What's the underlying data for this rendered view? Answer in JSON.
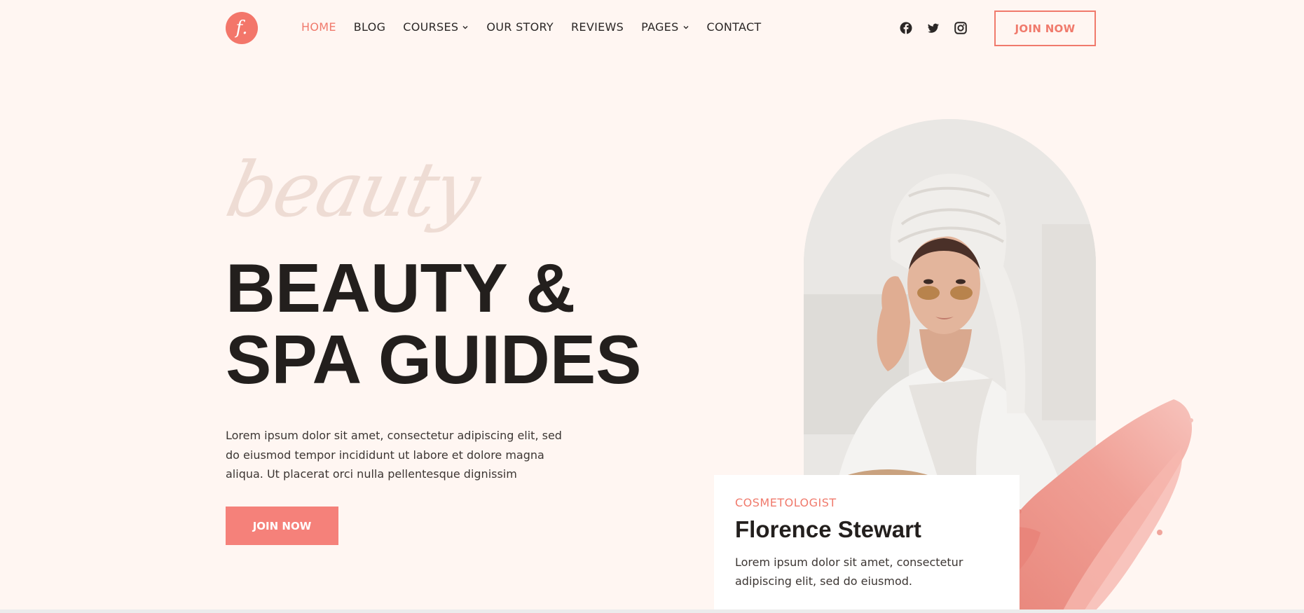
{
  "header": {
    "logo_text": "f.",
    "nav": [
      {
        "label": "HOME",
        "active": true,
        "dropdown": false
      },
      {
        "label": "BLOG",
        "active": false,
        "dropdown": false
      },
      {
        "label": "COURSES",
        "active": false,
        "dropdown": true
      },
      {
        "label": "OUR STORY",
        "active": false,
        "dropdown": false
      },
      {
        "label": "REVIEWS",
        "active": false,
        "dropdown": false
      },
      {
        "label": "PAGES",
        "active": false,
        "dropdown": true
      },
      {
        "label": "CONTACT",
        "active": false,
        "dropdown": false
      }
    ],
    "socials": [
      "facebook-icon",
      "twitter-icon",
      "instagram-icon"
    ],
    "cta_label": "JOIN NOW"
  },
  "hero": {
    "script_word": "beauty",
    "title_line1": "BEAUTY &",
    "title_line2": "SPA GUIDES",
    "description": "Lorem ipsum dolor sit amet, consectetur adipiscing elit, sed do eiusmod tempor incididunt ut labore et dolore magna aliqua. Ut placerat orci nulla pellentesque dignissim",
    "cta_label": "JOIN NOW"
  },
  "profile": {
    "role": "COSMETOLOGIST",
    "name": "Florence Stewart",
    "description": "Lorem ipsum dolor sit amet, consectetur adipiscing elit, sed do eiusmod."
  },
  "colors": {
    "accent": "#f07a6c",
    "background": "#fff6f2",
    "text": "#231f1d"
  }
}
